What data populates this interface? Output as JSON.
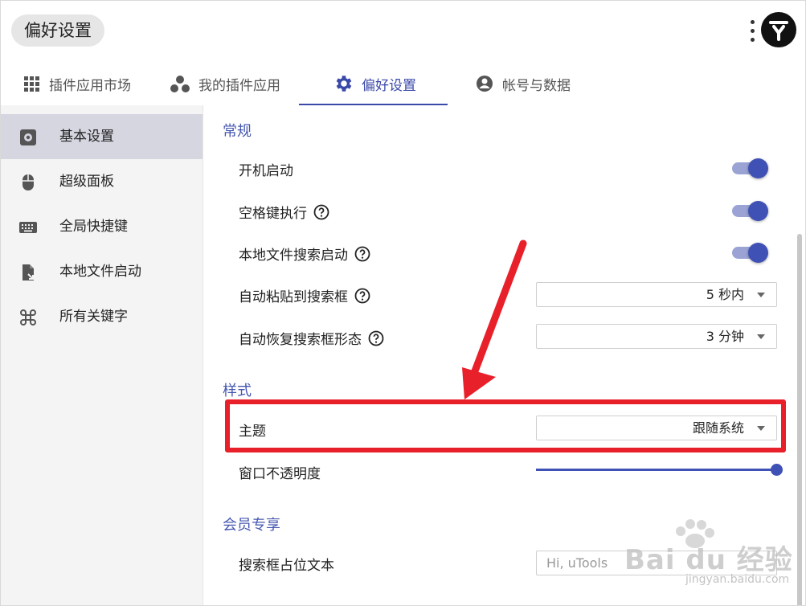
{
  "window": {
    "title": "偏好设置"
  },
  "tabs": [
    {
      "label": "插件应用市场",
      "icon": "grid-icon"
    },
    {
      "label": "我的插件应用",
      "icon": "cluster-icon"
    },
    {
      "label": "偏好设置",
      "icon": "gear-icon",
      "active": true
    },
    {
      "label": "帐号与数据",
      "icon": "account-icon"
    }
  ],
  "sidebar": {
    "items": [
      {
        "label": "基本设置",
        "icon": "settings-box-icon",
        "active": true
      },
      {
        "label": "超级面板",
        "icon": "mouse-icon"
      },
      {
        "label": "全局快捷键",
        "icon": "keyboard-icon"
      },
      {
        "label": "本地文件启动",
        "icon": "file-launch-icon"
      },
      {
        "label": "所有关键字",
        "icon": "command-icon"
      }
    ]
  },
  "main": {
    "sections": {
      "general": "常规",
      "style": "样式",
      "member": "会员专享"
    },
    "general": {
      "boot_start": {
        "label": "开机启动",
        "on": true
      },
      "space_exec": {
        "label": "空格键执行",
        "on": true
      },
      "local_file_search": {
        "label": "本地文件搜索启动",
        "on": true
      },
      "auto_paste": {
        "label": "自动粘贴到搜索框",
        "value": "5 秒内"
      },
      "auto_restore": {
        "label": "自动恢复搜索框形态",
        "value": "3 分钟"
      }
    },
    "style": {
      "theme": {
        "label": "主题",
        "value": "跟随系统"
      },
      "opacity": {
        "label": "窗口不透明度",
        "value_percent": 100
      }
    },
    "member": {
      "placeholder_text": {
        "label": "搜索框占位文本",
        "placeholder": "Hi, uTools"
      }
    }
  },
  "watermark": {
    "brand": "Bai du 经验",
    "url": "jingyan.baidu.com"
  },
  "colors": {
    "accent": "#3f51b5",
    "section_title": "#4557b0",
    "annotation_red": "#e8202a",
    "sidebar_active": "#d5d6e0"
  }
}
